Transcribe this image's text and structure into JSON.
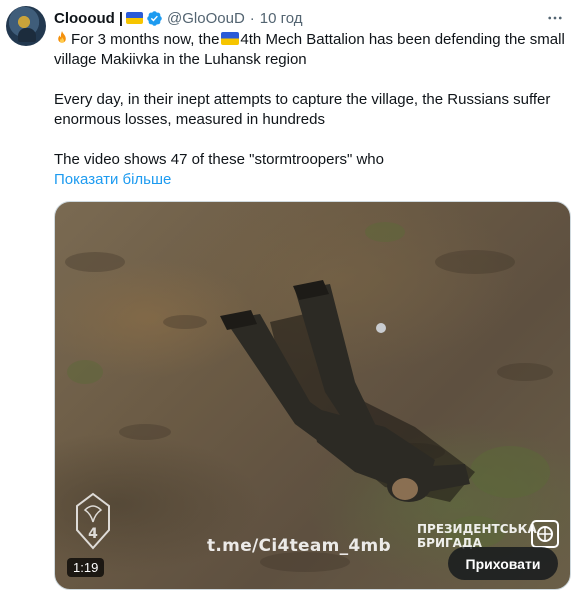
{
  "author": {
    "display_name": "Clooоud",
    "name_separator": "|",
    "handle": "@GloOouD",
    "time": "10 год",
    "dot": "·"
  },
  "tweet": {
    "line1": "For 3 months now, the",
    "line1b": "4th Mech Battalion has been defending the small village Makiivka in the Luhansk region",
    "para2": "Every day, in their inept attempts to capture the village, the Russians suffer enormous losses, measured in hundreds",
    "para3": "The video shows 47 of these \"stormtroopers\" who",
    "show_more": "Показати більше"
  },
  "media": {
    "watermark": "t.me/Ci4team_4mb",
    "brigade_line1": "ПРЕЗИДЕНТСЬКА",
    "brigade_line2": "БРИГАДА",
    "unit_number": "4",
    "duration": "1:19",
    "hide_button": "Приховати"
  },
  "icons": {
    "more": "more-dots-icon",
    "verified": "verified-badge-icon",
    "flag": "ukraine-flag-icon",
    "fire": "fire-emoji-icon"
  },
  "colors": {
    "text": "#0f1419",
    "muted": "#536471",
    "link": "#1d9bf0",
    "verified": "#1d9bf0",
    "flag_blue": "#2a5bd7",
    "flag_yellow": "#f6c500"
  }
}
